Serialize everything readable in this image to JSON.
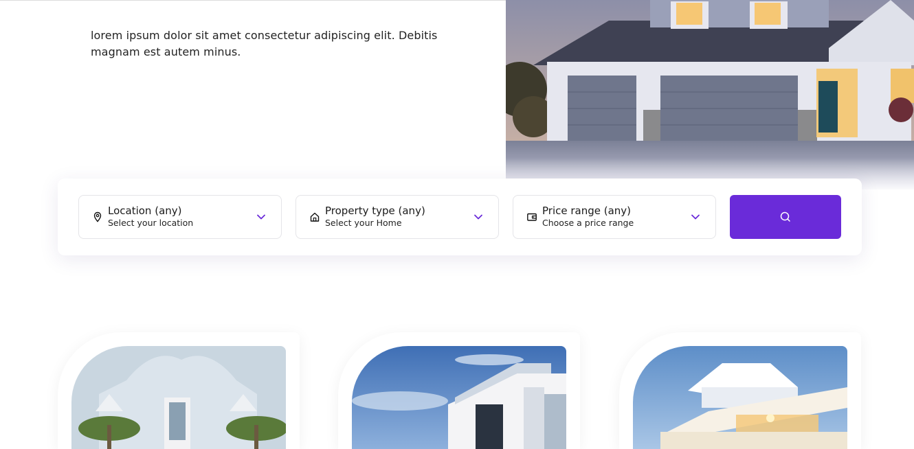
{
  "hero": {
    "description": "lorem ipsum dolor sit amet consectetur adipiscing elit. Debitis magnam est autem minus.",
    "image_icon": "house-photo"
  },
  "search": {
    "location": {
      "title": "Location (any)",
      "subtitle": "Select your location",
      "icon": "map-pin-icon"
    },
    "property_type": {
      "title": "Property type (any)",
      "subtitle": "Select your Home",
      "icon": "home-icon"
    },
    "price_range": {
      "title": "Price range (any)",
      "subtitle": "Choose a price range",
      "icon": "wallet-icon"
    },
    "button_icon": "search-icon"
  },
  "colors": {
    "accent": "#6a2bd9",
    "chevron": "#6a2bd9",
    "text": "#1c1c1c",
    "border": "#e4e4e8"
  },
  "listings": [
    {
      "icon": "house-photo"
    },
    {
      "icon": "house-photo"
    },
    {
      "icon": "house-photo"
    }
  ]
}
